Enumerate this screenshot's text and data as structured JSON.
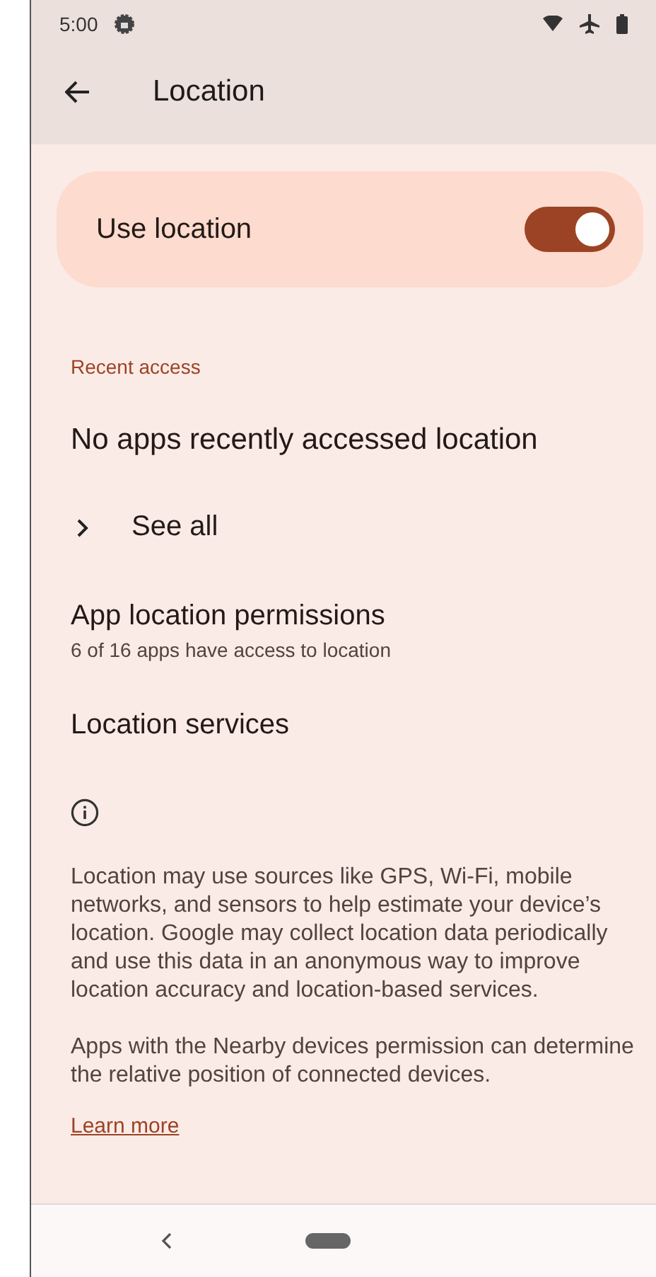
{
  "status_bar": {
    "time": "5:00"
  },
  "toolbar": {
    "title": "Location"
  },
  "main_switch": {
    "label": "Use location",
    "on": true
  },
  "recent_access": {
    "header": "Recent access",
    "empty_text": "No apps recently accessed location",
    "see_all": "See all"
  },
  "items": [
    {
      "title": "App location permissions",
      "summary": "6 of 16 apps have access to location"
    },
    {
      "title": "Location services"
    }
  ],
  "footer": {
    "paragraphs": [
      "Location may use sources like GPS, Wi-Fi, mobile networks, and sensors to help estimate your device’s location. Google may collect location data periodically and use this data in an anonymous way to improve location accuracy and location-based services.",
      "Apps with the Nearby devices permission can determine the relative position of connected devices."
    ],
    "link": "Learn more"
  }
}
